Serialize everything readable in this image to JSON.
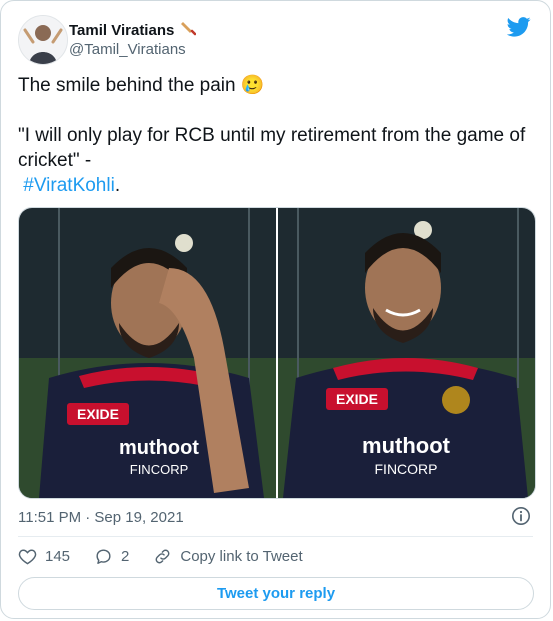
{
  "author": {
    "name": "Tamil Viratians",
    "handle": "@Tamil_Viratians"
  },
  "tweet": {
    "line1": "The smile behind the pain 🥲",
    "quote": "\"I will only play for RCB until my retirement from the game of cricket\" -",
    "hashtag": "#ViratKohli",
    "trailing": "."
  },
  "meta": {
    "timestamp": "11:51 PM · Sep 19, 2021"
  },
  "actions": {
    "likes": "145",
    "replies": "2",
    "copy_link": "Copy link to Tweet"
  },
  "reply_button": "Tweet your reply",
  "photos": [
    {
      "jersey_brand": "EXIDE",
      "sponsor": "muthoot",
      "sponsor_sub": "FINCORP"
    },
    {
      "jersey_brand": "EXIDE",
      "sponsor": "muthoot",
      "sponsor_sub": "FINCORP"
    }
  ],
  "colors": {
    "accent": "#1d9bf0",
    "like": "#536471",
    "jersey": "#1a1f3a",
    "jersey_red": "#c8102e"
  },
  "icons": {
    "logo": "twitter-bird-icon",
    "bat": "cricket-bat-icon",
    "info": "info-icon",
    "like": "heart-icon",
    "reply": "reply-bubble-icon",
    "link": "link-icon"
  }
}
